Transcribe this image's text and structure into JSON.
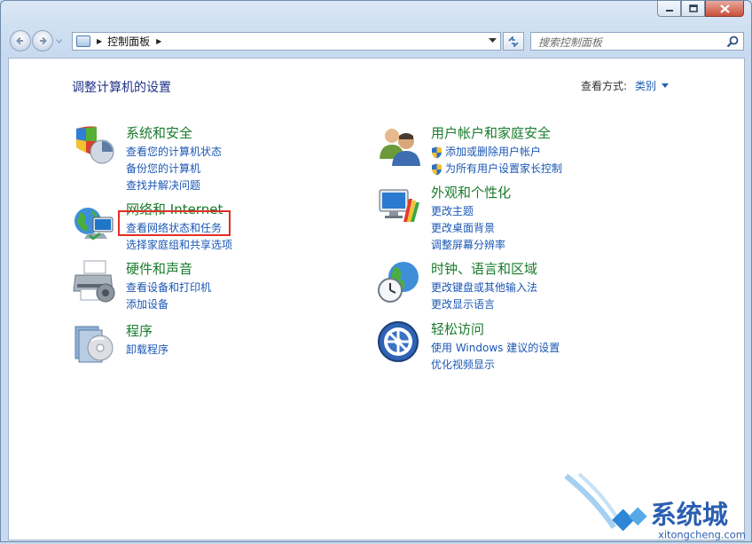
{
  "window": {
    "breadcrumb": [
      "控制面板"
    ],
    "search_placeholder": "搜索控制面板"
  },
  "header": {
    "title": "调整计算机的设置",
    "view_by_label": "查看方式:",
    "view_by_value": "类别"
  },
  "left_categories": [
    {
      "name": "系统和安全",
      "icon": "shield-icon",
      "links": [
        "查看您的计算机状态",
        "备份您的计算机",
        "查找并解决问题"
      ]
    },
    {
      "name": "网络和 Internet",
      "icon": "network-globe-icon",
      "links": [
        "查看网络状态和任务",
        "选择家庭组和共享选项"
      ]
    },
    {
      "name": "硬件和声音",
      "icon": "printer-icon",
      "links": [
        "查看设备和打印机",
        "添加设备"
      ]
    },
    {
      "name": "程序",
      "icon": "programs-disc-icon",
      "links": [
        "卸载程序"
      ]
    }
  ],
  "right_categories": [
    {
      "name": "用户帐户和家庭安全",
      "icon": "users-icon",
      "links": [
        "添加或删除用户帐户",
        "为所有用户设置家长控制"
      ]
    },
    {
      "name": "外观和个性化",
      "icon": "monitor-palette-icon",
      "links": [
        "更改主题",
        "更改桌面背景",
        "调整屏幕分辨率"
      ]
    },
    {
      "name": "时钟、语言和区域",
      "icon": "clock-globe-icon",
      "links": [
        "更改键盘或其他输入法",
        "更改显示语言"
      ]
    },
    {
      "name": "轻松访问",
      "icon": "ease-of-access-icon",
      "links": [
        "使用 Windows 建议的设置",
        "优化视频显示"
      ]
    }
  ],
  "annotation": {
    "highlight_color": "#e02f26"
  },
  "watermark": {
    "text": "系统城",
    "url_text": "xitongcheng.com"
  },
  "colors": {
    "heading": "#1a7b2d",
    "link": "#1b57b5",
    "title": "#1e3287"
  }
}
